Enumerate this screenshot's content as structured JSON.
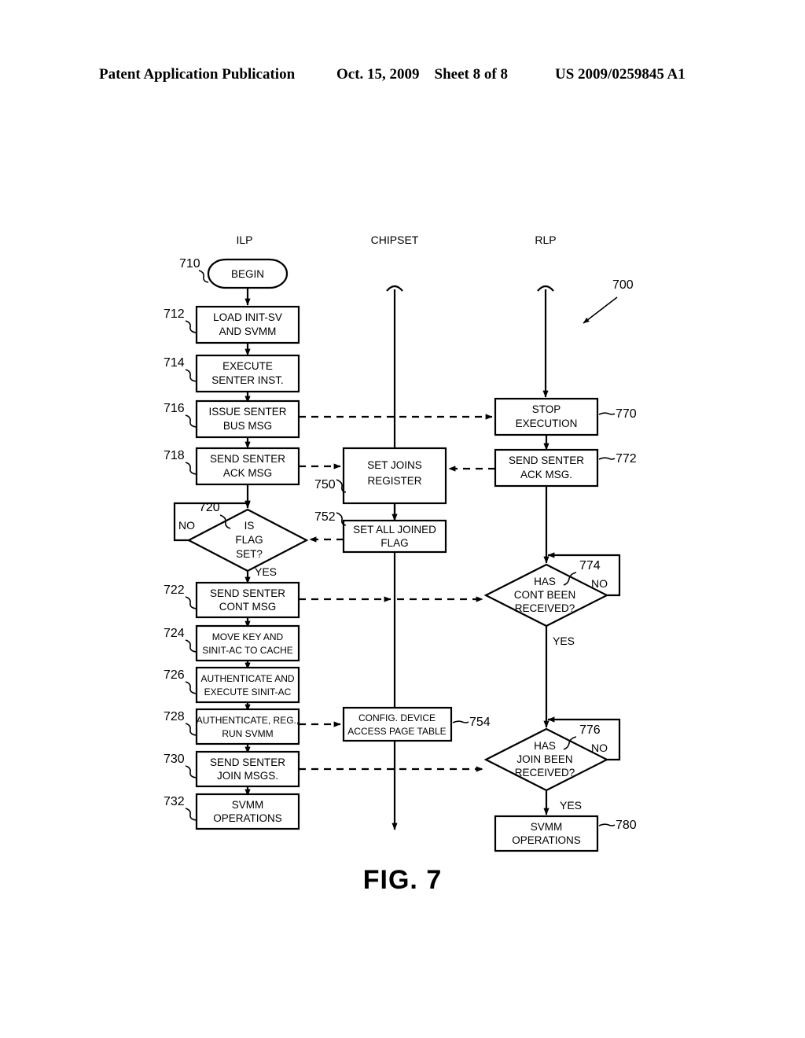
{
  "header": {
    "publication": "Patent Application Publication",
    "date": "Oct. 15, 2009",
    "sheet": "Sheet 8 of 8",
    "number": "US 2009/0259845 A1"
  },
  "figure": {
    "caption": "FIG. 7",
    "diagram_ref": "700",
    "columns": [
      {
        "id": "ilp",
        "label": "ILP"
      },
      {
        "id": "chipset",
        "label": "CHIPSET"
      },
      {
        "id": "rlp",
        "label": "RLP"
      }
    ],
    "nodes": [
      {
        "ref": "710",
        "column": "ilp",
        "shape": "terminator",
        "text": [
          "BEGIN"
        ]
      },
      {
        "ref": "712",
        "column": "ilp",
        "shape": "process",
        "text": [
          "LOAD INIT-SV",
          "AND SVMM"
        ]
      },
      {
        "ref": "714",
        "column": "ilp",
        "shape": "process",
        "text": [
          "EXECUTE",
          "SENTER INST."
        ]
      },
      {
        "ref": "716",
        "column": "ilp",
        "shape": "process",
        "text": [
          "ISSUE SENTER",
          "BUS MSG"
        ]
      },
      {
        "ref": "718",
        "column": "ilp",
        "shape": "process",
        "text": [
          "SEND SENTER",
          "ACK MSG"
        ]
      },
      {
        "ref": "720",
        "column": "ilp",
        "shape": "decision",
        "text": [
          "IS",
          "FLAG",
          "SET?"
        ],
        "branches": [
          "NO",
          "YES"
        ]
      },
      {
        "ref": "722",
        "column": "ilp",
        "shape": "process",
        "text": [
          "SEND SENTER",
          "CONT MSG"
        ]
      },
      {
        "ref": "724",
        "column": "ilp",
        "shape": "process",
        "text": [
          "MOVE KEY AND",
          "SINIT-AC TO CACHE"
        ]
      },
      {
        "ref": "726",
        "column": "ilp",
        "shape": "process",
        "text": [
          "AUTHENTICATE AND",
          "EXECUTE SINIT-AC"
        ]
      },
      {
        "ref": "728",
        "column": "ilp",
        "shape": "process",
        "text": [
          "AUTHENTICATE, REG.,",
          "RUN SVMM"
        ]
      },
      {
        "ref": "730",
        "column": "ilp",
        "shape": "process",
        "text": [
          "SEND SENTER",
          "JOIN MSGS."
        ]
      },
      {
        "ref": "732",
        "column": "ilp",
        "shape": "process",
        "text": [
          "SVMM",
          "OPERATIONS"
        ]
      },
      {
        "ref": "750",
        "column": "chipset",
        "shape": "process",
        "text": [
          "SET JOINS",
          "REGISTER"
        ]
      },
      {
        "ref": "752",
        "column": "chipset",
        "shape": "process",
        "text": [
          "SET ALL JOINED",
          "FLAG"
        ]
      },
      {
        "ref": "754",
        "column": "chipset",
        "shape": "process",
        "text": [
          "CONFIG. DEVICE",
          "ACCESS PAGE TABLE"
        ]
      },
      {
        "ref": "770",
        "column": "rlp",
        "shape": "process",
        "text": [
          "STOP",
          "EXECUTION"
        ]
      },
      {
        "ref": "772",
        "column": "rlp",
        "shape": "process",
        "text": [
          "SEND SENTER",
          "ACK MSG."
        ]
      },
      {
        "ref": "774",
        "column": "rlp",
        "shape": "decision",
        "text": [
          "HAS",
          "CONT BEEN",
          "RECEIVED?"
        ],
        "branches": [
          "NO",
          "YES"
        ]
      },
      {
        "ref": "776",
        "column": "rlp",
        "shape": "decision",
        "text": [
          "HAS",
          "JOIN BEEN",
          "RECEIVED?"
        ],
        "branches": [
          "NO",
          "YES"
        ]
      },
      {
        "ref": "780",
        "column": "rlp",
        "shape": "process",
        "text": [
          "SVMM",
          "OPERATIONS"
        ]
      }
    ]
  },
  "labels": {
    "col_ilp": "ILP",
    "col_chipset": "CHIPSET",
    "col_rlp": "RLP",
    "n710_text": "BEGIN",
    "n712_l1": "LOAD INIT-SV",
    "n712_l2": "AND SVMM",
    "n714_l1": "EXECUTE",
    "n714_l2": "SENTER INST.",
    "n716_l1": "ISSUE SENTER",
    "n716_l2": "BUS MSG",
    "n718_l1": "SEND SENTER",
    "n718_l2": "ACK MSG",
    "n720_l1": "IS",
    "n720_l2": "FLAG",
    "n720_l3": "SET?",
    "n720_no": "NO",
    "n720_yes": "YES",
    "n722_l1": "SEND SENTER",
    "n722_l2": "CONT MSG",
    "n724_l1": "MOVE KEY AND",
    "n724_l2": "SINIT-AC TO CACHE",
    "n726_l1": "AUTHENTICATE AND",
    "n726_l2": "EXECUTE SINIT-AC",
    "n728_l1": "AUTHENTICATE, REG.,",
    "n728_l2": "RUN SVMM",
    "n730_l1": "SEND SENTER",
    "n730_l2": "JOIN MSGS.",
    "n732_l1": "SVMM",
    "n732_l2": "OPERATIONS",
    "n750_l1": "SET JOINS",
    "n750_l2": "REGISTER",
    "n752_l1": "SET ALL JOINED",
    "n752_l2": "FLAG",
    "n754_l1": "CONFIG. DEVICE",
    "n754_l2": "ACCESS PAGE TABLE",
    "n770_l1": "STOP",
    "n770_l2": "EXECUTION",
    "n772_l1": "SEND SENTER",
    "n772_l2": "ACK MSG.",
    "n774_l1": "HAS",
    "n774_l2": "CONT BEEN",
    "n774_l3": "RECEIVED?",
    "n774_no": "NO",
    "n774_yes": "YES",
    "n776_l1": "HAS",
    "n776_l2": "JOIN BEEN",
    "n776_l3": "RECEIVED?",
    "n776_no": "NO",
    "n776_yes": "YES",
    "n780_l1": "SVMM",
    "n780_l2": "OPERATIONS",
    "ref_710": "710",
    "ref_712": "712",
    "ref_714": "714",
    "ref_716": "716",
    "ref_718": "718",
    "ref_720": "720",
    "ref_722": "722",
    "ref_724": "724",
    "ref_726": "726",
    "ref_728": "728",
    "ref_730": "730",
    "ref_732": "732",
    "ref_750": "750",
    "ref_752": "752",
    "ref_754": "754",
    "ref_770": "770",
    "ref_772": "772",
    "ref_774": "774",
    "ref_776": "776",
    "ref_780": "780",
    "ref_700": "700",
    "figcap": "FIG. 7"
  }
}
